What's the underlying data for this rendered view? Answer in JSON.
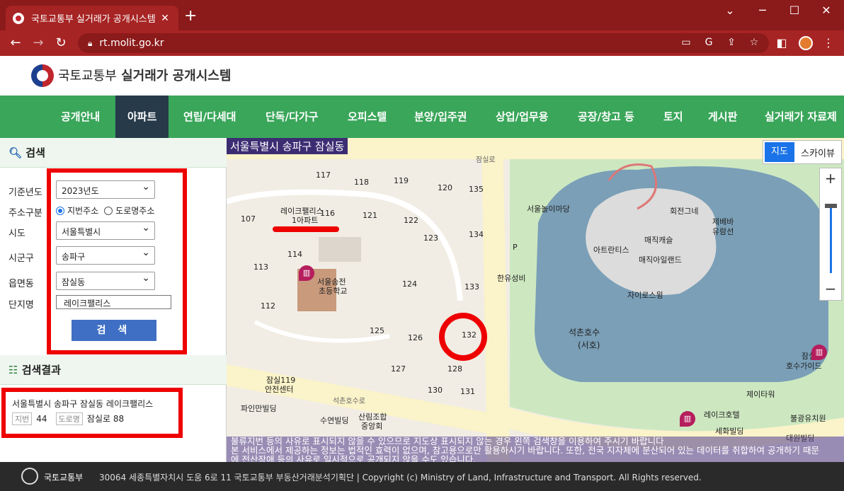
{
  "browser": {
    "tab_title": "국토교통부 실거래가 공개시스템",
    "tab_close": "✕",
    "new_tab": "+",
    "url": "rt.molit.go.kr",
    "minimize": "─",
    "maximize": "☐",
    "close": "✕"
  },
  "site": {
    "ministry": "국토교통부",
    "system": "실거래가 공개시스템"
  },
  "nav": [
    {
      "label": "공개안내"
    },
    {
      "label": "아파트",
      "active": true
    },
    {
      "label": "연립/다세대"
    },
    {
      "label": "단독/다가구"
    },
    {
      "label": "오피스텔"
    },
    {
      "label": "분양/입주권"
    },
    {
      "label": "상업/업무용"
    },
    {
      "label": "공장/창고 등"
    },
    {
      "label": "토지"
    },
    {
      "label": "게시판"
    },
    {
      "label": "실거래가 자료제"
    }
  ],
  "search": {
    "heading": "검색",
    "year_label": "기준년도",
    "year_value": "2023년도",
    "addr_type_label": "주소구분",
    "addr_jibun": "지번주소",
    "addr_road": "도로명주소",
    "sido_label": "시도",
    "sido_value": "서울특별시",
    "sigungu_label": "시군구",
    "sigungu_value": "송파구",
    "dong_label": "읍면동",
    "dong_value": "잠실동",
    "complex_label": "단지명",
    "complex_value": "레이크팰리스",
    "button": "검 색"
  },
  "results": {
    "heading": "검색결과",
    "line1": "서울특별시 송파구 잠실동",
    "complex": "레이크팰리스",
    "jibun_chip": "지번",
    "jibun_value": "44",
    "road_chip": "도로명",
    "road_value": "잠실로 88"
  },
  "map": {
    "title": "서울특별시 송파구 잠실동",
    "toggle_map": "지도",
    "toggle_sky": "스카이뷰",
    "zoom_in": "+",
    "zoom_out": "−",
    "labels": {
      "lake_palace": "레이크팰리스",
      "apt": "1아파트",
      "school1": "서울송전",
      "school2": "초등학교",
      "hanyu": "한유성비",
      "jamsil_road": "잠실로",
      "seokchon_road": "석촌호수로",
      "seokchon_lake": "석촌호수",
      "seoho": "(서호)",
      "magic_island": "매직아일랜드",
      "magic_castle": "매직캐슬",
      "atlantis": "아트란티스",
      "seoul_madang": "서울놀이마당",
      "merry_go": "회전그네",
      "jebi": "제베바",
      "yuramseon": "유람선",
      "gyro": "자이로스윙",
      "fire1": "잠실119",
      "fire2": "안전센터",
      "pine": "파인만빌딩",
      "suyeon": "수연빌딩",
      "sillim1": "산림조합",
      "sillim2": "중앙회",
      "jamsil_ho1": "잠실레",
      "jamsil_ho2": "호수가이드",
      "jtower": "제이타워",
      "lake_hotel": "레이크호텔",
      "bulyang": "불광유치원",
      "sehwa": "세화빌딩",
      "daewon": "대원빌딩",
      "p": "P",
      "b107": "107",
      "b116": "116",
      "b117": "117",
      "b118": "118",
      "b119": "119",
      "b120": "120",
      "b121": "121",
      "b122": "122",
      "b123": "123",
      "b124": "124",
      "b125": "125",
      "b126": "126",
      "b127": "127",
      "b128": "128",
      "b130": "130",
      "b131": "131",
      "b132": "132",
      "b133": "133",
      "b134": "134",
      "b135": "135",
      "b112": "112",
      "b113": "113",
      "b114": "114"
    },
    "notice_line1": "불류지번 등의 사유로 표시되지 않을 수 있으므로 지도상 표시되지 않는 경우 왼쪽 검색창을 이용하여 주시기 바랍니다",
    "notice_line2": "본 서비스에서 제공하는 정보는 법적인 효력이 없으며, 참고용으로만 활용하시기 바랍니다. 또한, 전국 지자체에 분산되어 있는 데이터를 취합하여 공개하기 때문",
    "notice_line3": "에 전산장애 등의 사유로 일시적으로 공개되지 않을 수도 있습니다."
  },
  "footer": {
    "ministry": "국토교통부",
    "address": "30064 세종특별자치시 도움 6로 11 국토교통부 부동산거래분석기획단  |  Copyright (c) Ministry of Land, Infrastructure and Transport. All Rights reserved."
  },
  "colors": {
    "chrome": "#a72424",
    "nav_green": "#3aa65a",
    "nav_active": "#263a4a",
    "highlight_red": "#ee0000",
    "search_button": "#3f6fc4"
  }
}
